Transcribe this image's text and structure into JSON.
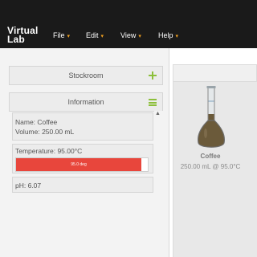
{
  "app": {
    "logo_line1": "Virtual",
    "logo_line2": "Lab"
  },
  "menu": {
    "items": [
      {
        "label": "File"
      },
      {
        "label": "Edit"
      },
      {
        "label": "View"
      },
      {
        "label": "Help"
      }
    ],
    "caret": "▾"
  },
  "sidebar": {
    "stockroom": {
      "title": "Stockroom",
      "icon": "plus-icon"
    },
    "information": {
      "title": "Information",
      "icon": "menu-icon"
    }
  },
  "info": {
    "name_line": "Name: Coffee",
    "volume_line": "Volume: 250.00 mL",
    "temperature_line": "Temperature: 95.00°C",
    "temperature_bar_label": "95.0 deg",
    "temperature_fill_fraction": 0.95,
    "ph_line": "pH: 6.07"
  },
  "workbench": {
    "item_name": "Coffee",
    "item_detail": "250.00 mL @ 95.0°C"
  },
  "colors": {
    "accent_green": "#8cbf3a",
    "caret_orange": "#f0a020",
    "temp_red": "#e8463c"
  }
}
